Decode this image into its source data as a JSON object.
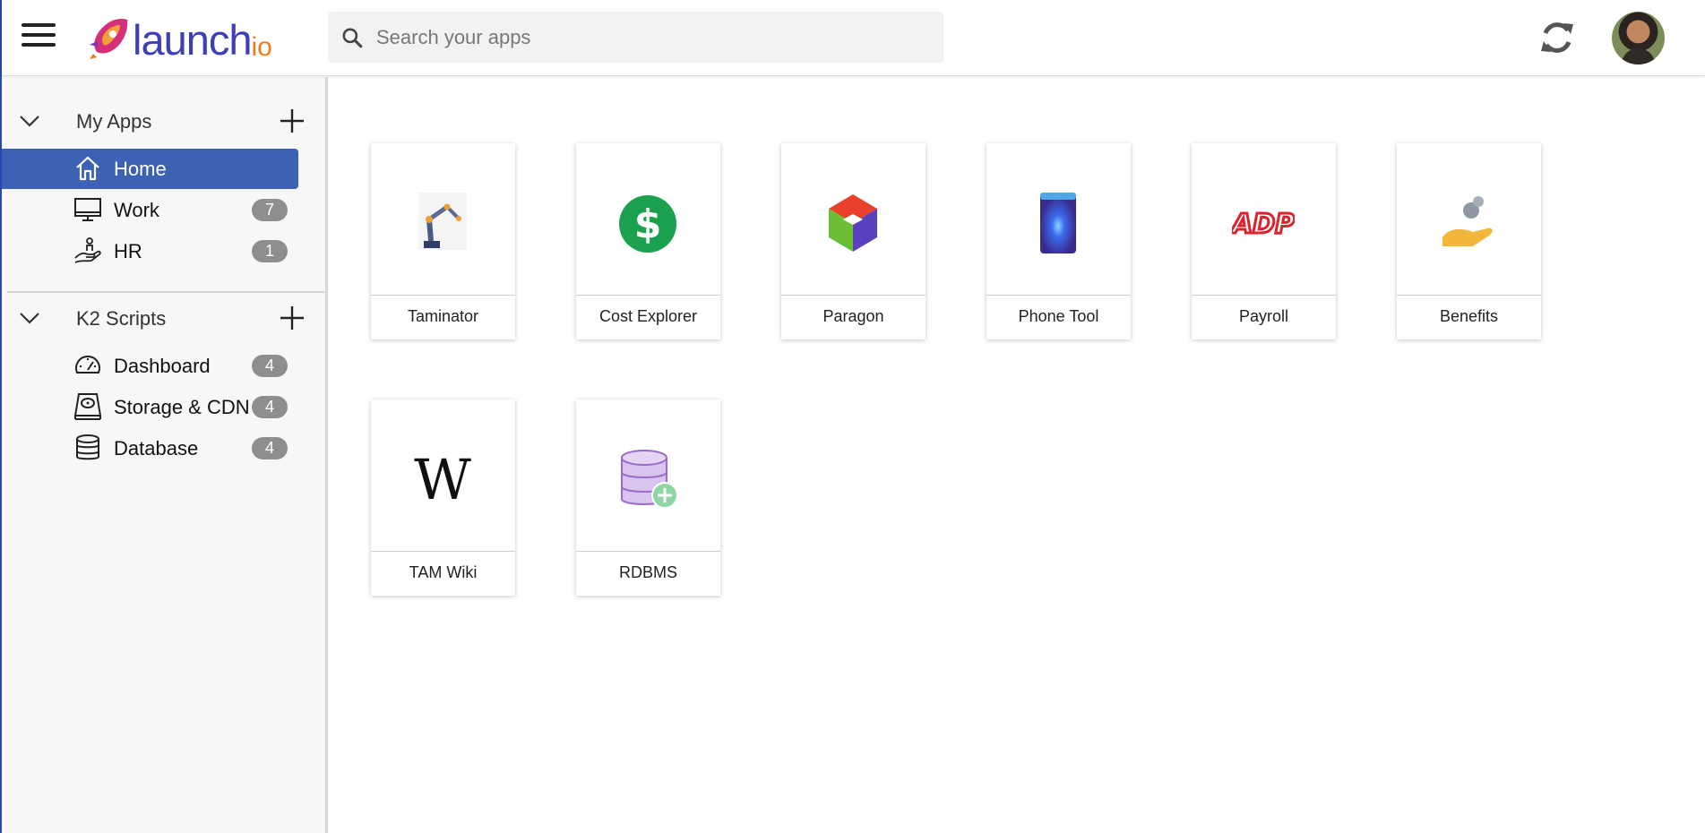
{
  "header": {
    "logo_text": "launch",
    "logo_suffix": "io",
    "search_placeholder": "Search your apps"
  },
  "sidebar": {
    "sections": [
      {
        "title": "My Apps",
        "items": [
          {
            "label": "Home",
            "icon": "home-icon",
            "active": true
          },
          {
            "label": "Work",
            "icon": "monitor-icon",
            "count": "7"
          },
          {
            "label": "HR",
            "icon": "hand-person-icon",
            "count": "1"
          }
        ]
      },
      {
        "title": "K2 Scripts",
        "items": [
          {
            "label": "Dashboard",
            "icon": "speedometer-icon",
            "count": "4"
          },
          {
            "label": "Storage & CDN",
            "icon": "hard-drive-icon",
            "count": "4"
          },
          {
            "label": "Database",
            "icon": "database-icon",
            "count": "4"
          }
        ]
      }
    ]
  },
  "apps": [
    {
      "name": "Taminator",
      "icon": "robot-arm-icon"
    },
    {
      "name": "Cost Explorer",
      "icon": "dollar-icon"
    },
    {
      "name": "Paragon",
      "icon": "paragon-cube-icon"
    },
    {
      "name": "Phone Tool",
      "icon": "phone-icon"
    },
    {
      "name": "Payroll",
      "icon": "adp-logo-icon"
    },
    {
      "name": "Benefits",
      "icon": "coin-hand-icon"
    },
    {
      "name": "TAM Wiki",
      "icon": "wikipedia-icon"
    },
    {
      "name": "RDBMS",
      "icon": "database-add-icon"
    }
  ],
  "colors": {
    "accent": "#3d62b3",
    "logo_primary": "#3c3fb5",
    "logo_secondary": "#f07b1a",
    "badge": "#8e8e8e"
  }
}
